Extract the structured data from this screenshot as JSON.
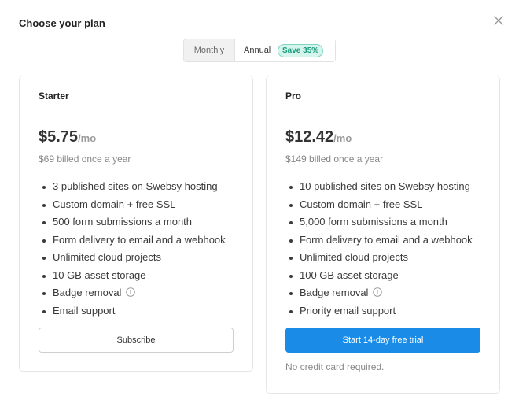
{
  "modal": {
    "title": "Choose your plan",
    "close_icon": "close-icon"
  },
  "billing_toggle": {
    "options": [
      "Monthly",
      "Annual"
    ],
    "selected": "Annual",
    "badge": "Save 35%"
  },
  "plans": [
    {
      "name": "Starter",
      "price": "$5.75",
      "period": "/mo",
      "billed": "$69 billed once a year",
      "features": [
        "3 published sites on Swebsy hosting",
        "Custom domain + free SSL",
        "500 form submissions a month",
        "Form delivery to email and a webhook",
        "Unlimited cloud projects",
        "10 GB asset storage",
        "Badge removal",
        "Email support"
      ],
      "cta": "Subscribe"
    },
    {
      "name": "Pro",
      "price": "$12.42",
      "period": "/mo",
      "billed": "$149 billed once a year",
      "features": [
        "10 published sites on Swebsy hosting",
        "Custom domain + free SSL",
        "5,000 form submissions a month",
        "Form delivery to email and a webhook",
        "Unlimited cloud projects",
        "100 GB asset storage",
        "Badge removal",
        "Priority email support"
      ],
      "cta": "Start 14-day free trial",
      "note": "No credit card required."
    }
  ],
  "colors": {
    "primary": "#1a8ce8",
    "badge_text": "#1a9b7e",
    "badge_bg": "#d5f4ec"
  }
}
